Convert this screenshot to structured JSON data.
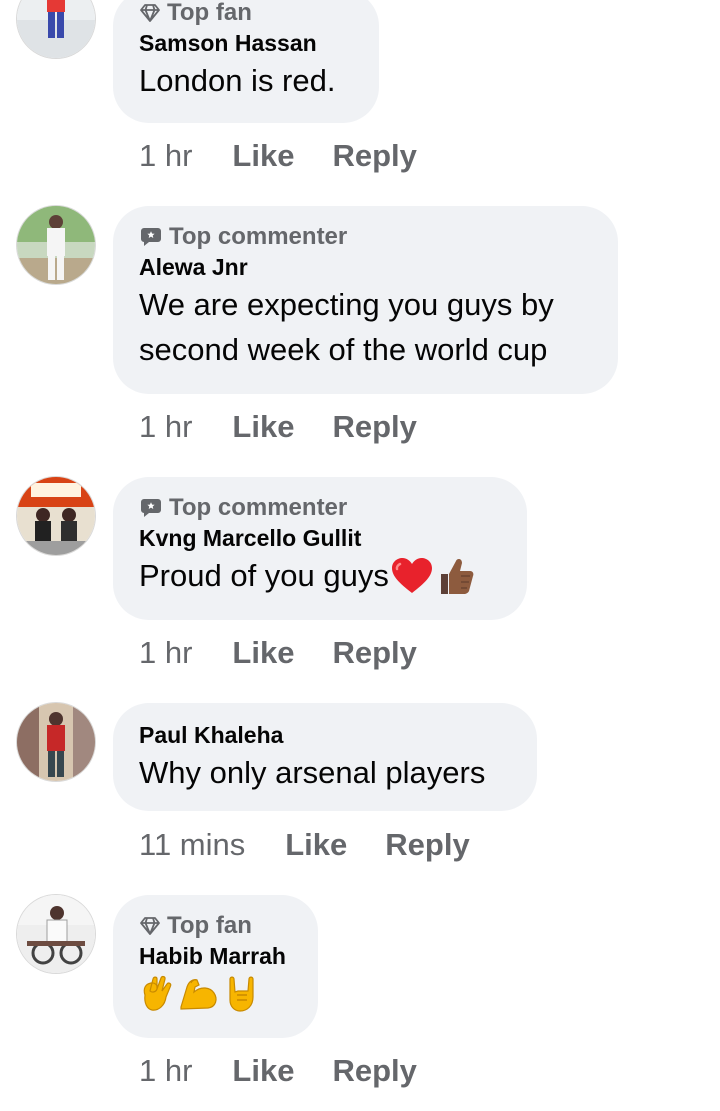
{
  "comments": [
    {
      "badge": "Top fan",
      "badge_icon": "diamond-icon",
      "author": "Samson Hassan",
      "text": "London is red.",
      "time": "1 hr",
      "like": "Like",
      "reply": "Reply"
    },
    {
      "badge": "Top commenter",
      "badge_icon": "speech-bubble-icon",
      "author": "Alewa Jnr",
      "text_lines": [
        "We are expecting you guys by",
        "second week of the world cup"
      ],
      "time": "1 hr",
      "like": "Like",
      "reply": "Reply"
    },
    {
      "badge": "Top commenter",
      "badge_icon": "speech-bubble-icon",
      "author": "Kvng Marcello Gullit",
      "text": "Proud of you guys",
      "emoji_suffix": [
        "red-heart-icon",
        "thumbs-up-icon"
      ],
      "time": "1 hr",
      "like": "Like",
      "reply": "Reply"
    },
    {
      "author": "Paul Khaleha",
      "text": "Why only arsenal players",
      "time": "11 mins",
      "like": "Like",
      "reply": "Reply"
    },
    {
      "badge": "Top fan",
      "badge_icon": "diamond-icon",
      "author": "Habib Marrah",
      "emojis": [
        "ok-hand-icon",
        "flexed-biceps-icon",
        "sign-of-horns-icon"
      ],
      "time": "1 hr",
      "like": "Like",
      "reply": "Reply"
    }
  ],
  "colors": {
    "bubble": "#f0f2f5",
    "meta_text": "#65676b",
    "main_text": "#050505"
  }
}
